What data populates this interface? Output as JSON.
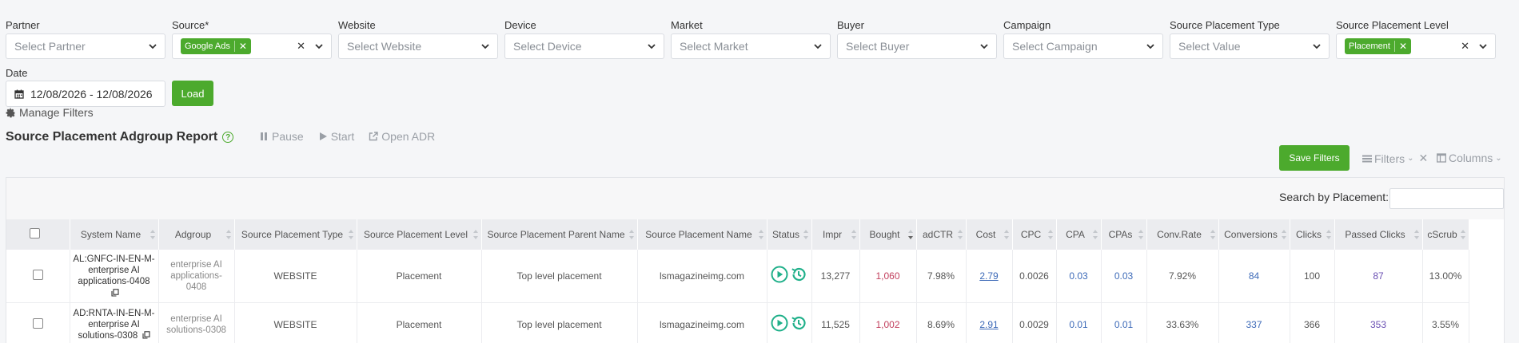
{
  "filters": [
    {
      "label": "Partner",
      "placeholder": "Select Partner",
      "tag": null
    },
    {
      "label": "Source*",
      "placeholder": "",
      "tag": "Google Ads"
    },
    {
      "label": "Website",
      "placeholder": "Select Website",
      "tag": null
    },
    {
      "label": "Device",
      "placeholder": "Select Device",
      "tag": null
    },
    {
      "label": "Market",
      "placeholder": "Select Market",
      "tag": null
    },
    {
      "label": "Buyer",
      "placeholder": "Select Buyer",
      "tag": null
    },
    {
      "label": "Campaign",
      "placeholder": "Select Campaign",
      "tag": null
    },
    {
      "label": "Source Placement Type",
      "placeholder": "Select Value",
      "tag": null
    },
    {
      "label": "Source Placement Level",
      "placeholder": "",
      "tag": "Placement"
    }
  ],
  "date": {
    "label": "Date",
    "value": "12/08/2026 - 12/08/2026"
  },
  "load_label": "Load",
  "manage_filters": "Manage Filters",
  "report_title": "Source Placement Adgroup Report",
  "actions": {
    "pause": "Pause",
    "start": "Start",
    "open_adr": "Open ADR"
  },
  "save_filters": "Save Filters",
  "filters_menu": "Filters",
  "columns_menu": "Columns",
  "search_label": "Search by Placement:",
  "columns": [
    "System Name",
    "Adgroup",
    "Source Placement Type",
    "Source Placement Level",
    "Source Placement Parent Name",
    "Source Placement Name",
    "Status",
    "Impr",
    "Bought",
    "adCTR",
    "Cost",
    "CPC",
    "CPA",
    "CPAs",
    "Conv.Rate",
    "Conversions",
    "Clicks",
    "Passed Clicks",
    "cScrub"
  ],
  "rows": [
    {
      "system_name": "AL:GNFC-IN-EN-M-enterprise AI applications-0408",
      "adgroup": "enterprise AI applications-0408",
      "type": "WEBSITE",
      "level": "Placement",
      "parent": "Top level placement",
      "placement": "lsmagazineimg.com",
      "impr": "13,277",
      "bought": "1,060",
      "adctr": "7.98%",
      "cost": "2.79",
      "cpc": "0.0026",
      "cpa": "0.03",
      "cpas": "0.03",
      "conv_rate": "7.92%",
      "conversions": "84",
      "clicks": "100",
      "passed_clicks": "87",
      "cscrub": "13.00%"
    },
    {
      "system_name": "AD:RNTA-IN-EN-M-enterprise AI solutions-0308",
      "adgroup": "enterprise AI solutions-0308",
      "type": "WEBSITE",
      "level": "Placement",
      "parent": "Top level placement",
      "placement": "lsmagazineimg.com",
      "impr": "11,525",
      "bought": "1,002",
      "adctr": "8.69%",
      "cost": "2.91",
      "cpc": "0.0029",
      "cpa": "0.01",
      "cpas": "0.01",
      "conv_rate": "33.63%",
      "conversions": "337",
      "clicks": "366",
      "passed_clicks": "353",
      "cscrub": "3.55%"
    }
  ],
  "colors": {
    "accent_green": "#4caa2d",
    "status_teal": "#20b08a",
    "link_blue": "#3d6ab8",
    "bought_red": "#c2405e"
  }
}
